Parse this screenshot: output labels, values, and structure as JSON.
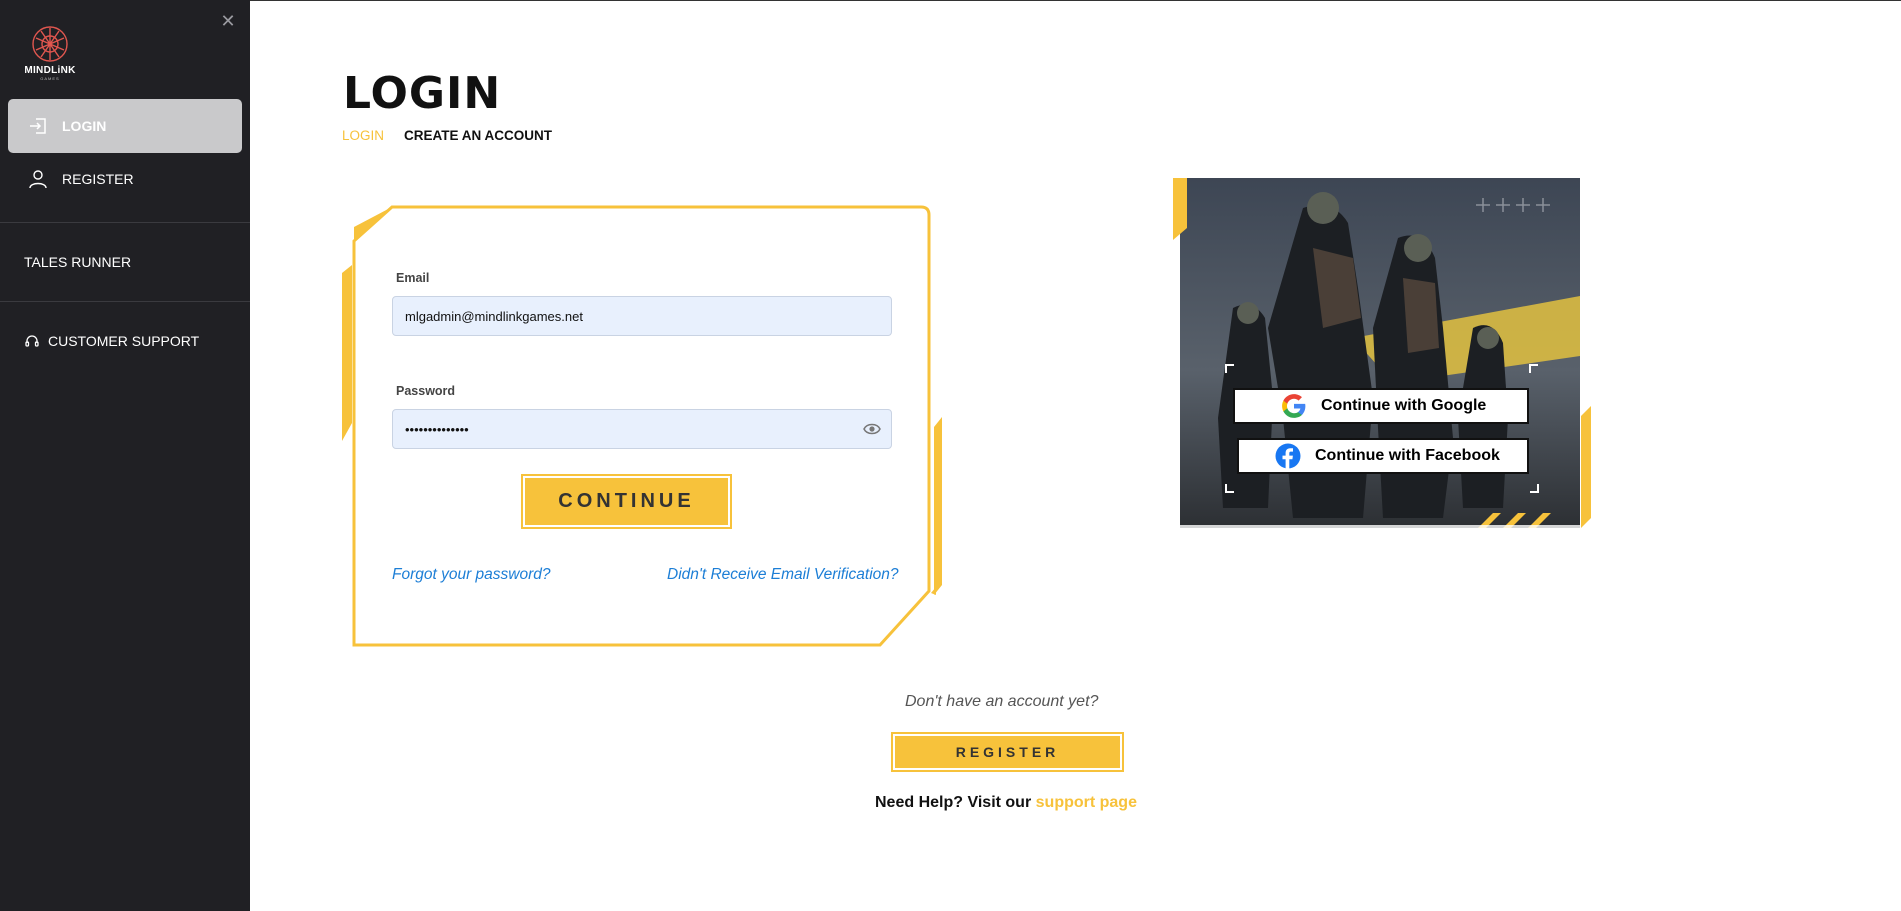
{
  "colors": {
    "accent": "#f7c23b",
    "sidebar_bg": "#202024",
    "link": "#1c7ed6",
    "field_bg": "#e8f0fd"
  },
  "brand": {
    "name": "MINDLiNK",
    "sub": "GAMES"
  },
  "sidebar": {
    "items": [
      {
        "label": "LOGIN",
        "icon": "login-icon",
        "active": true
      },
      {
        "label": "REGISTER",
        "icon": "user-icon",
        "active": false
      }
    ],
    "game_link": "TALES RUNNER",
    "support_link": "CUSTOMER SUPPORT"
  },
  "main": {
    "title": "LOGIN",
    "tabs": [
      {
        "label": "LOGIN",
        "active": true
      },
      {
        "label": "CREATE AN ACCOUNT",
        "active": false
      }
    ],
    "form": {
      "email_label": "Email",
      "email_value": "mlgadmin@mindlinkgames.net",
      "password_label": "Password",
      "password_value": "••••••••••••••",
      "continue_label": "CONTINUE",
      "forgot_link": "Forgot your password?",
      "verify_link": "Didn't Receive Email Verification?"
    },
    "social": {
      "google_label": "Continue with Google",
      "facebook_label": "Continue with Facebook"
    },
    "no_account_text": "Don't have an account yet?",
    "register_label": "REGISTER",
    "help_text": "Need Help? Visit our",
    "support_link": "support page"
  }
}
